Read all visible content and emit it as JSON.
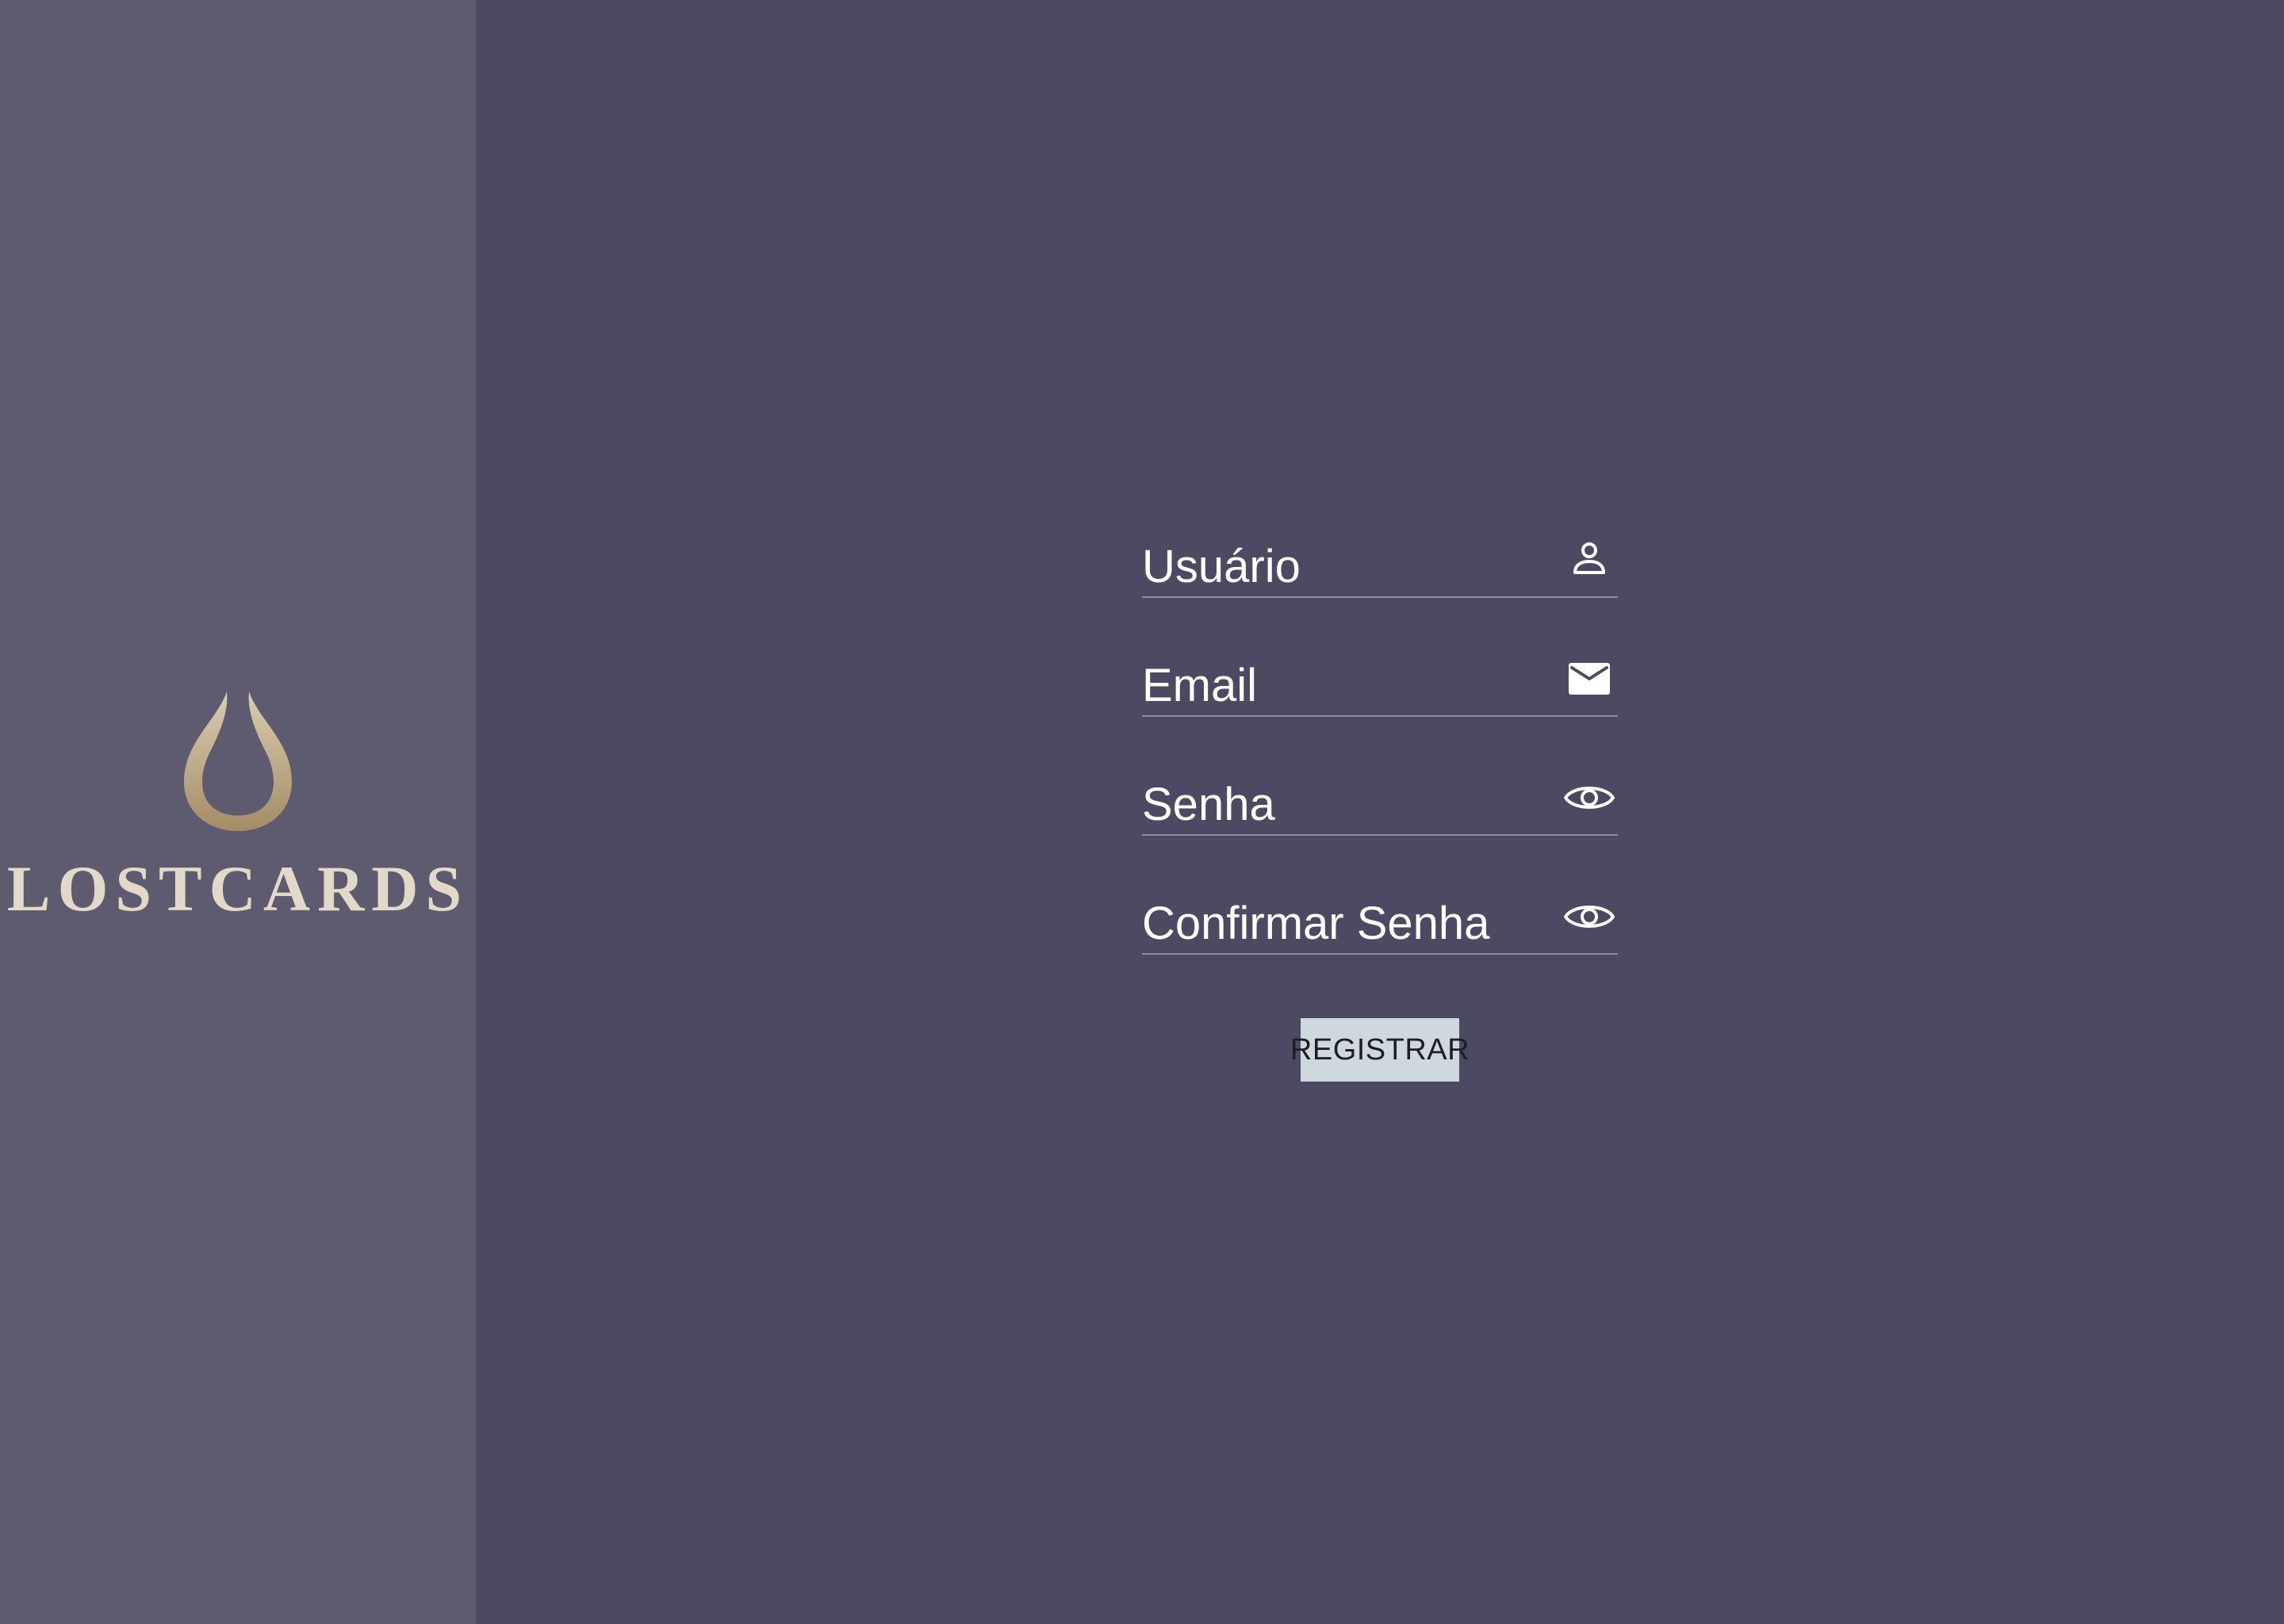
{
  "brand": {
    "name": "LOSTCARDS",
    "logo_icon": "droplet-logo-icon",
    "text_color": "#e3d9c9",
    "logo_gradient": [
      "#d7c9a8",
      "#a7906a"
    ]
  },
  "colors": {
    "background": "#4c4a62",
    "sidebar": "#5e5b71",
    "field_underline": "#8e8ca0",
    "button": "#cfd8dc"
  },
  "form": {
    "fields": [
      {
        "label": "Usuário",
        "icon": "person-icon"
      },
      {
        "label": "Email",
        "icon": "mail-icon"
      },
      {
        "label": "Senha",
        "icon": "eye-icon"
      },
      {
        "label": "Confirmar Senha",
        "icon": "eye-icon"
      }
    ],
    "submit_label": "REGISTRAR"
  }
}
